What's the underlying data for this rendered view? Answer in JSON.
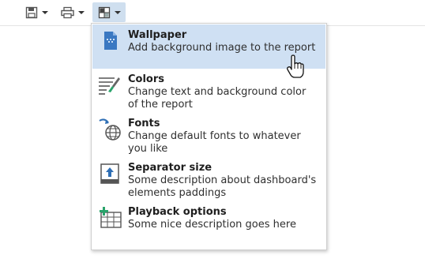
{
  "toolbar": {
    "buttons": [
      {
        "icon": "save-icon",
        "has_dropdown": true
      },
      {
        "icon": "print-icon",
        "has_dropdown": true
      },
      {
        "icon": "layout-icon",
        "has_dropdown": true,
        "active": true
      }
    ]
  },
  "menu": {
    "items": [
      {
        "title": "Wallpaper",
        "description": "Add background image to the report",
        "icon": "wallpaper-icon",
        "highlighted": true
      },
      {
        "title": "Colors",
        "description": "Change text and background color of the report",
        "icon": "colors-icon"
      },
      {
        "title": "Fonts",
        "description": "Change default fonts to whatever you like",
        "icon": "fonts-icon"
      },
      {
        "title": "Separator size",
        "description": "Some description about dashboard's elements paddings",
        "icon": "separator-size-icon"
      },
      {
        "title": "Playback options",
        "description": "Some nice description goes here",
        "icon": "playback-options-icon"
      }
    ]
  },
  "colors": {
    "highlight": "#cfe0f3",
    "accent_blue": "#2f6fb5",
    "accent_green": "#2aa36b"
  }
}
